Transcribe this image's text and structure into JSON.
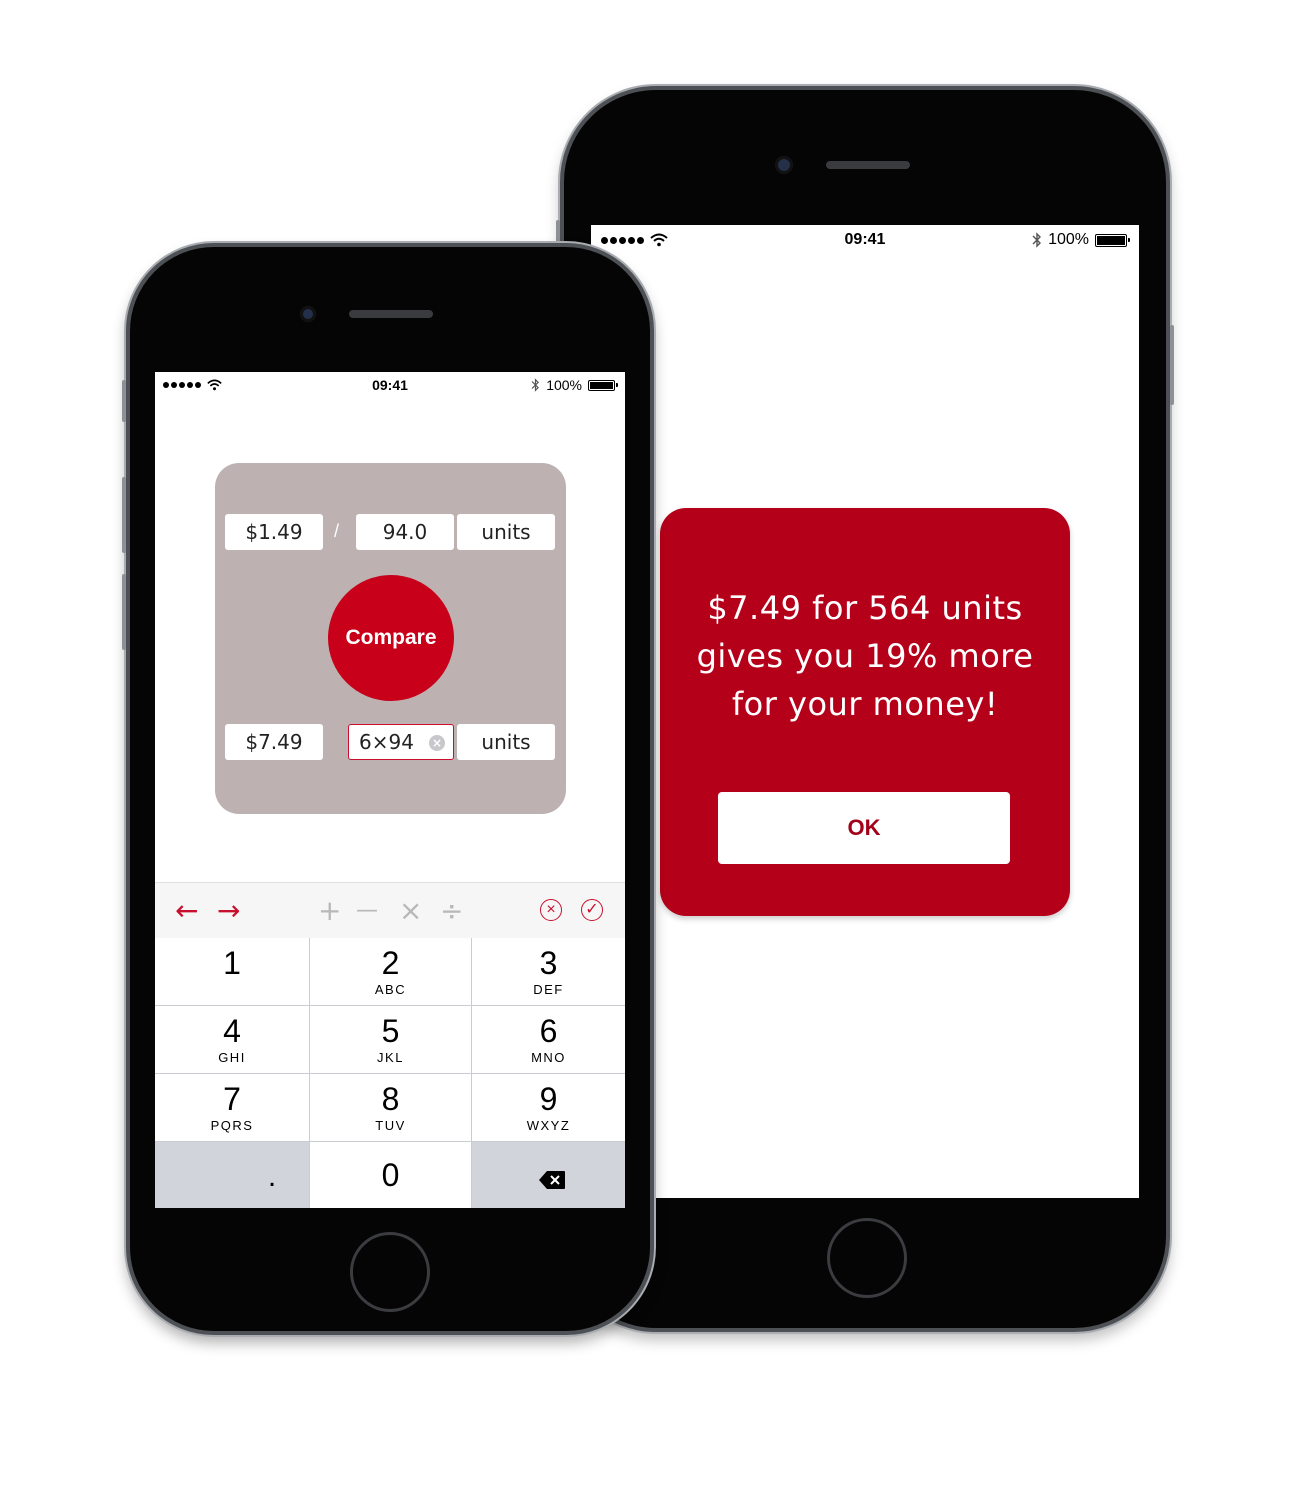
{
  "status_bar": {
    "time": "09:41",
    "battery": "100%",
    "icons": [
      "signal-dots-icon",
      "wifi-icon",
      "bluetooth-icon",
      "battery-icon"
    ]
  },
  "result": {
    "message": "$7.49 for 564 units gives you 19% more for your money!",
    "ok_label": "OK"
  },
  "compare": {
    "row1": {
      "price": "$1.49",
      "separator": "/",
      "quantity": "94.0",
      "unit": "units"
    },
    "row2": {
      "price": "$7.49",
      "quantity": "6×94",
      "unit": "units"
    },
    "button_label": "Compare"
  },
  "toolbar": {
    "left_arrow": "←",
    "right_arrow": "→",
    "plus": "+",
    "minus": "—",
    "times": "×",
    "divide": "÷",
    "cancel": "⊗",
    "confirm": "✓"
  },
  "keypad": {
    "keys": [
      {
        "num": "1",
        "letters": ""
      },
      {
        "num": "2",
        "letters": "ABC"
      },
      {
        "num": "3",
        "letters": "DEF"
      },
      {
        "num": "4",
        "letters": "GHI"
      },
      {
        "num": "5",
        "letters": "JKL"
      },
      {
        "num": "6",
        "letters": "MNO"
      },
      {
        "num": "7",
        "letters": "PQRS"
      },
      {
        "num": "8",
        "letters": "TUV"
      },
      {
        "num": "9",
        "letters": "WXYZ"
      }
    ],
    "dot": ".",
    "zero": "0"
  },
  "colors": {
    "accent_red": "#c8001a",
    "card_red": "#b5001a",
    "panel_taupe": "#bdb1b1",
    "keypad_gray": "#d1d5db"
  }
}
